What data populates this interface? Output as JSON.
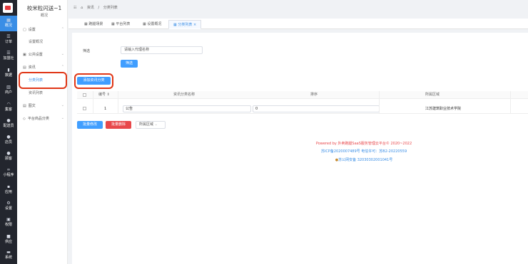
{
  "rail": {
    "items": [
      {
        "label": "概况",
        "icon": "grid-icon"
      },
      {
        "label": "订单",
        "icon": "list-icon"
      },
      {
        "label": "加盟社",
        "icon": "list-icon"
      },
      {
        "label": "数据",
        "icon": "chart-icon"
      },
      {
        "label": "商户",
        "icon": "store-icon"
      },
      {
        "label": "集客",
        "icon": "headset-icon"
      },
      {
        "label": "配送员",
        "icon": "person-icon"
      },
      {
        "label": "店员",
        "icon": "person-icon"
      },
      {
        "label": "顾客",
        "icon": "person-icon"
      },
      {
        "label": "小程序",
        "icon": "link-icon"
      },
      {
        "label": "应用",
        "icon": "apps-icon"
      },
      {
        "label": "设置",
        "icon": "gear-icon"
      },
      {
        "label": "权限",
        "icon": "lock-icon"
      },
      {
        "label": "供应",
        "icon": "box-icon"
      },
      {
        "label": "系统",
        "icon": "monitor-icon"
      }
    ]
  },
  "menu": {
    "shop_name": "校米粒闪送~1",
    "shop_sub": "概况",
    "groups": [
      {
        "label": "设置"
      },
      {
        "label": "公共设置"
      },
      {
        "label": "资讯"
      },
      {
        "label": "图文"
      },
      {
        "label": "平台商品分类"
      }
    ],
    "subs": {
      "settings_overview": "设置概况",
      "category_list": "分类列表",
      "article_list": "资讯列表"
    }
  },
  "breadcrumb": {
    "home": "⌂",
    "section": "资讯",
    "page": "分类列表"
  },
  "tabs": [
    {
      "label": "跑腿场景"
    },
    {
      "label": "平台列表"
    },
    {
      "label": "设置概况"
    },
    {
      "label": "分类列表"
    }
  ],
  "filter": {
    "label": "筛选",
    "placeholder": "请输入代理名称",
    "button": "筛选"
  },
  "add_button": "添加资讯分类",
  "table": {
    "headers": [
      "编号 ⇕",
      "资讯分类名称",
      "排序",
      "所属区域"
    ],
    "rows": [
      {
        "id": "1",
        "name": "公告",
        "sort": "0",
        "region": "江苏建筑职业技术学院"
      }
    ]
  },
  "actions": {
    "batch_edit": "批量修改",
    "batch_delete": "批量删除",
    "region_select": "所属区域"
  },
  "footer": {
    "powered": "Powered by 外卖跑腿SaaS服务管理云平台© 2020~2022",
    "icp": "苏ICP备2020007489号    电信许可：苏B2-20220559",
    "police": "苏公网安备 32030302001041号"
  }
}
